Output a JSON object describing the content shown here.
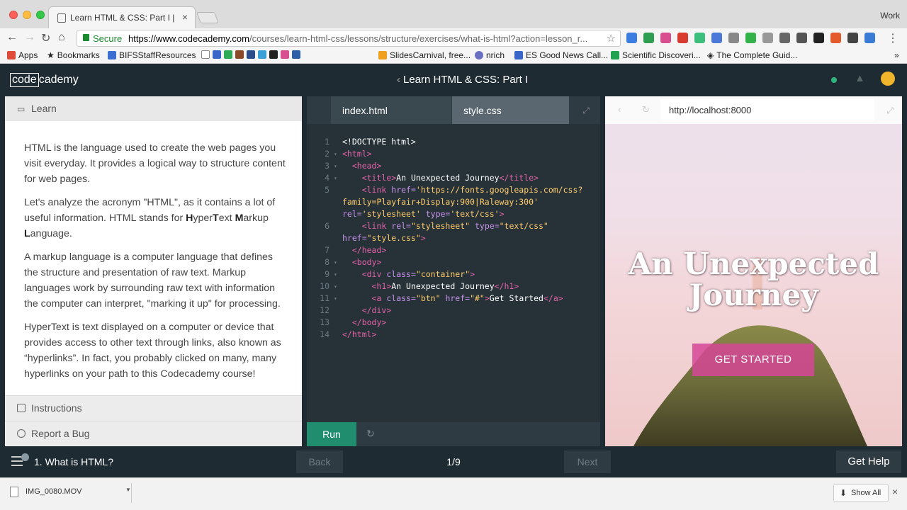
{
  "browser": {
    "tab_title": "Learn HTML & CSS: Part I | Co",
    "tab_close": "×",
    "profile": "Work",
    "secure_label": "Secure",
    "url_host": "https://www.codecademy.com",
    "url_rest": "/courses/learn-html-css/lessons/structure/exercises/what-is-html?action=lesson_r...",
    "bookmarks": [
      {
        "label": "Apps",
        "color": "#e04a3a"
      },
      {
        "label": "Bookmarks",
        "color": "#555555"
      },
      {
        "label": "BIFSStaffResources",
        "color": "#3b6fd1"
      },
      {
        "label": "SlidesCarnival, free...",
        "color": "#f0a020"
      },
      {
        "label": "nrich",
        "color": "#6a6fbf"
      },
      {
        "label": "ES Good News Call...",
        "color": "#3a66c9"
      },
      {
        "label": "Scientific Discoveri...",
        "color": "#22a352"
      },
      {
        "label": "The Complete Guid...",
        "color": "#333333"
      }
    ]
  },
  "header": {
    "logo_boxed": "code",
    "logo_rest": "cademy",
    "course_title": "Learn HTML & CSS: Part I",
    "course_chevron": "‹"
  },
  "learn": {
    "header_label": "Learn",
    "p1": "HTML is the language used to create the web pages you visit everyday. It provides a logical way to structure content for web pages.",
    "p2_a": "Let's analyze the acronym \"HTML\", as it contains a lot of useful information. HTML stands for ",
    "p2_h": "H",
    "p2_yper": "yper",
    "p2_t": "T",
    "p2_ext": "ext ",
    "p2_m": "M",
    "p2_arkup": "arkup ",
    "p2_l": "L",
    "p2_anguage": "anguage.",
    "p3": "A markup language is a computer language that defines the structure and presentation of raw text. Markup languages work by surrounding raw text with information the computer can interpret, \"marking it up\" for processing.",
    "p4": "HyperText is text displayed on a computer or device that provides access to other text through links, also known as “hyperlinks”. In fact, you probably clicked on many, many hyperlinks on your path to this Codecademy course!",
    "instructions_label": "Instructions",
    "report_bug_label": "Report a Bug"
  },
  "editor": {
    "tab_active": "index.html",
    "tab_inactive": "style.css",
    "run_label": "Run",
    "reset_icon": "↻",
    "expand_icon": "⤢"
  },
  "preview": {
    "url": "http://localhost:8000",
    "heading": "An Unexpected Journey",
    "button_label": "GET STARTED",
    "back_icon": "‹",
    "reload_icon": "↻"
  },
  "footer": {
    "lesson_name": "1. What is HTML?",
    "back_label": "Back",
    "progress": "1/9",
    "next_label": "Next",
    "help_label": "Get Help"
  },
  "downloads": {
    "file_name": "IMG_0080.MOV",
    "show_all_label": "Show All",
    "close_icon": "×"
  }
}
